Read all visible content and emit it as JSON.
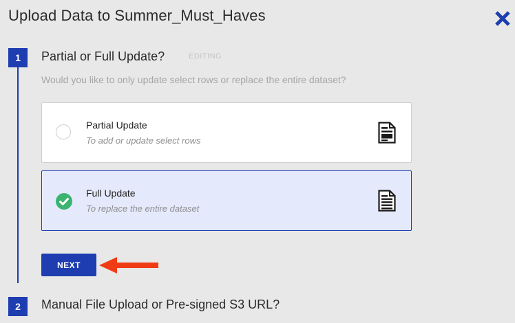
{
  "dialog": {
    "title": "Upload Data to Summer_Must_Haves"
  },
  "steps": [
    {
      "number": "1",
      "title": "Partial or Full Update?",
      "status": "EDITING",
      "question": "Would you like to only update select rows or replace the entire dataset?",
      "options": [
        {
          "label": "Partial Update",
          "description": "To add or update select rows",
          "selected": false,
          "icon": "document-partial-icon"
        },
        {
          "label": "Full Update",
          "description": "To replace the entire dataset",
          "selected": true,
          "icon": "document-full-icon"
        }
      ],
      "next_label": "NEXT"
    },
    {
      "number": "2",
      "title": "Manual File Upload or Pre-signed S3 URL?"
    }
  ],
  "colors": {
    "accent": "#1d3db0",
    "selected_bg": "#e4e9fb",
    "check_green": "#3cb371",
    "annotation_arrow": "#f03c14"
  }
}
